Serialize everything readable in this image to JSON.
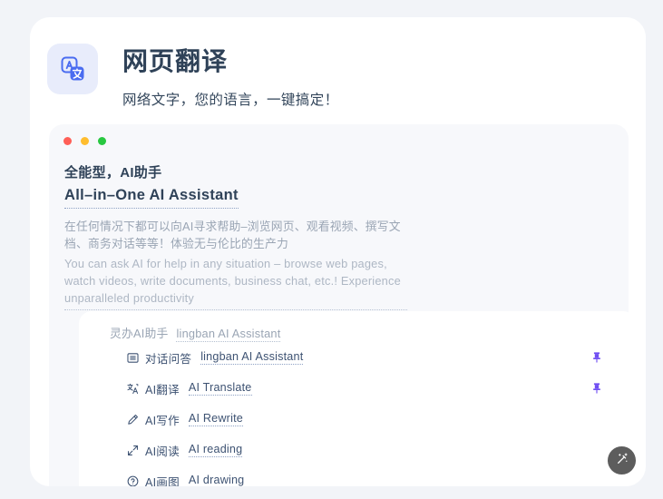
{
  "header": {
    "icon": "translate-icon",
    "title": "网页翻译",
    "subtitle": "网络文字，您的语言，一键搞定！"
  },
  "window_dots": [
    {
      "name": "close-dot",
      "color": "#ff5f57"
    },
    {
      "name": "minimize-dot",
      "color": "#ffbd2e"
    },
    {
      "name": "maximize-dot",
      "color": "#28c840"
    }
  ],
  "panel": {
    "headline_zh": "全能型，AI助手",
    "headline_en": "All–in–One AI Assistant",
    "description_zh": "在任何情况下都可以向AI寻求帮助–浏览网页、观看视频、撰写文档、商务对话等等！体验无与伦比的生产力",
    "description_en": "You can ask AI for help in any situation – browse web pages, watch videos, write documents, business chat, etc.! Experience unparalleled productivity"
  },
  "list": {
    "group_zh": "灵办AI助手",
    "group_en": "lingban AI Assistant",
    "items": [
      {
        "icon": "panel-layout-icon",
        "zh": "对话问答",
        "en": "lingban AI Assistant",
        "pinned": true
      },
      {
        "icon": "translate-icon",
        "zh": "AI翻译",
        "en": "AI Translate",
        "pinned": true
      },
      {
        "icon": "pencil-icon",
        "zh": "AI写作",
        "en": "AI Rewrite",
        "pinned": false
      },
      {
        "icon": "expand-arrows-icon",
        "zh": "AI阅读",
        "en": "AI reading",
        "pinned": false
      },
      {
        "icon": "question-circle-icon",
        "zh": "AI画图",
        "en": "AI drawing",
        "pinned": false
      }
    ]
  },
  "fab": {
    "icon": "magic-wand-icon",
    "background": "#5d5d5d"
  },
  "colors": {
    "page_background": "#f2f4f8",
    "card_background": "#ffffff",
    "panel_background": "#f7f8fb",
    "accent_blue": "#4a6cf0",
    "pin_purple": "#6f4ef2",
    "text_dark": "#2f4258",
    "text_muted": "#9aa5b4"
  }
}
